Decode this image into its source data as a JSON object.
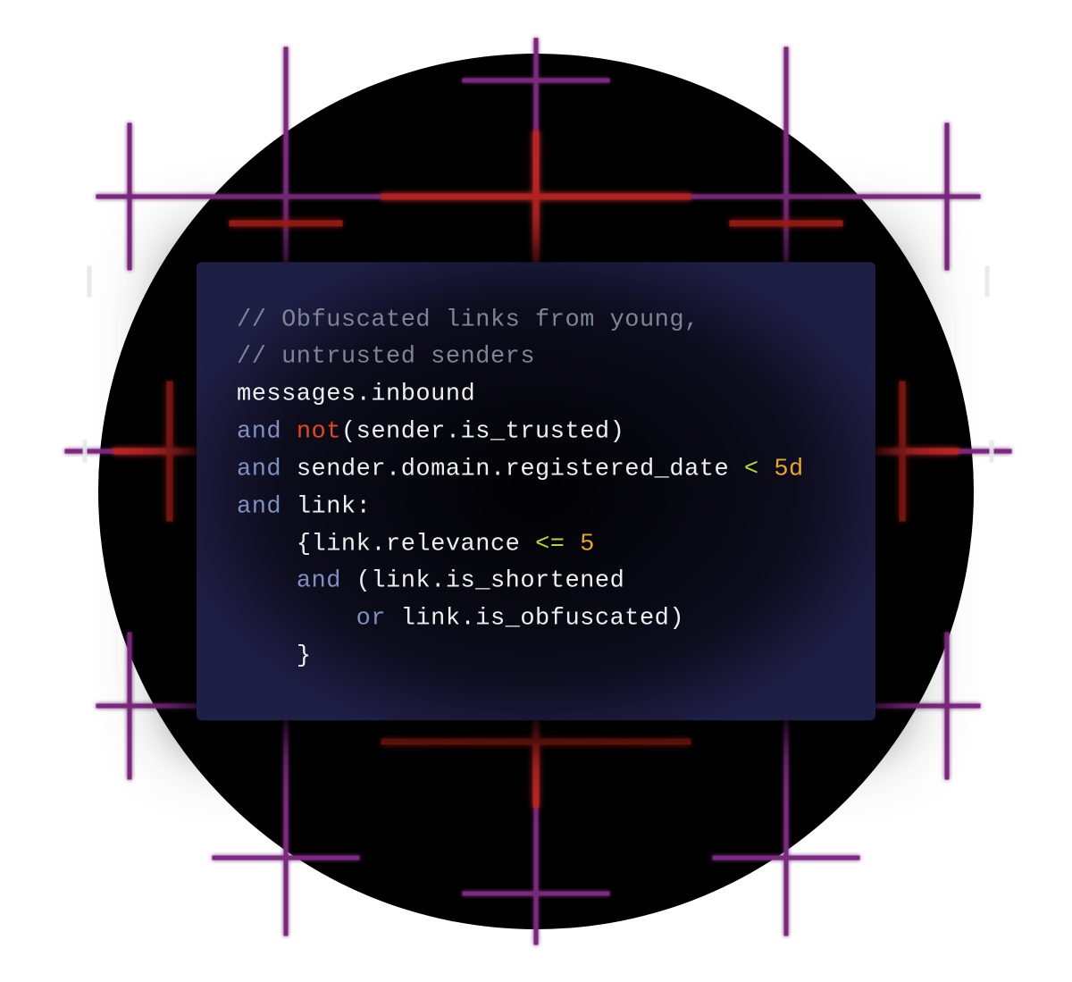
{
  "code": {
    "comment1": "// Obfuscated links from young,",
    "comment2": "// untrusted senders",
    "line3_ident": "messages.inbound",
    "line4_and": "and",
    "line4_not": "not",
    "line4_rest": "(sender.is_trusted)",
    "line5_and": "and",
    "line5_ident": "sender.domain.registered_date",
    "line5_op": "<",
    "line5_val": "5d",
    "line6_and": "and",
    "line6_ident": "link:",
    "line7_open": "{",
    "line7_ident": "link.relevance",
    "line7_op": "<=",
    "line7_val": "5",
    "line8_and": "and",
    "line8_rest": "(link.is_shortened",
    "line9_or": "or",
    "line9_rest": "link.is_obfuscated)",
    "line10_close": "}"
  }
}
